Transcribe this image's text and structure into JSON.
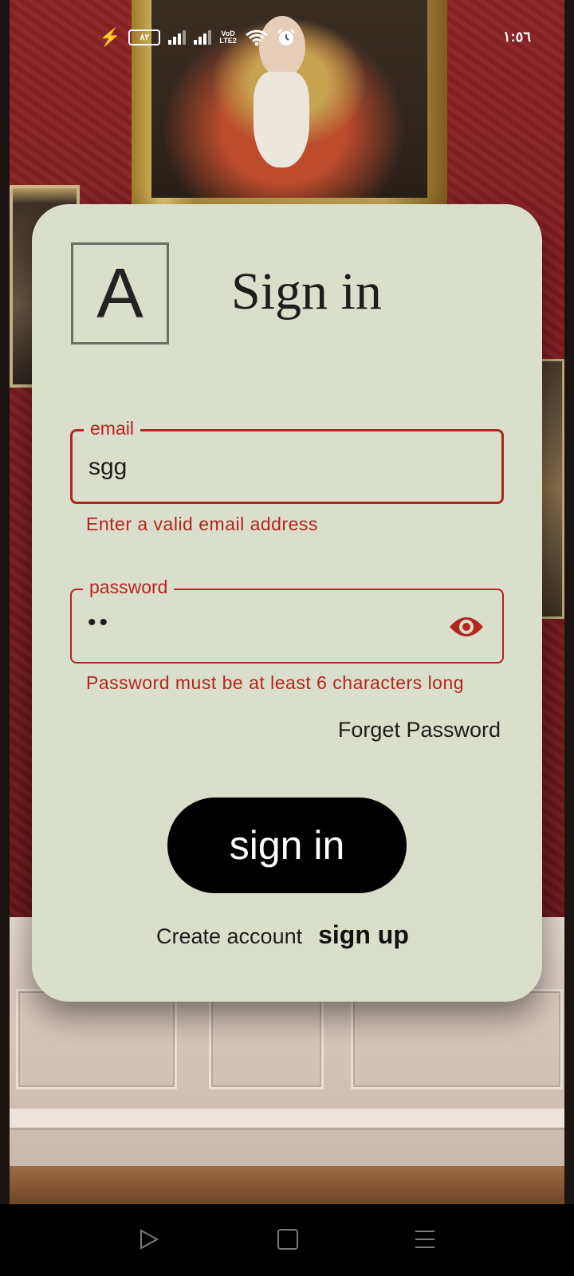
{
  "status_bar": {
    "time": "١:٥٦",
    "battery_level": "٨٢",
    "network_label_top": "VoD",
    "network_label_bottom": "LTE2",
    "icons": [
      "charging-icon",
      "battery-icon",
      "signal-icon",
      "signal-icon",
      "volte-icon",
      "wifi-icon",
      "alarm-icon"
    ]
  },
  "card": {
    "logo_letter": "A",
    "title": "Sign in",
    "email_field": {
      "label": "email",
      "value": "sgg",
      "error": "Enter a valid email address"
    },
    "password_field": {
      "label": "password",
      "value": "••",
      "error": "Password must be at least 6 characters long",
      "toggle_icon": "eye-icon"
    },
    "forget_password": "Forget Password",
    "sign_in_button": "sign in",
    "create_account_text": "Create account",
    "sign_up_link": "sign up"
  },
  "navigation_bar": {
    "icons": [
      "back-icon",
      "home-icon",
      "menu-icon"
    ]
  },
  "colors": {
    "card_background": "#d9dfcb",
    "error": "#b3261e",
    "button": "#000000"
  }
}
